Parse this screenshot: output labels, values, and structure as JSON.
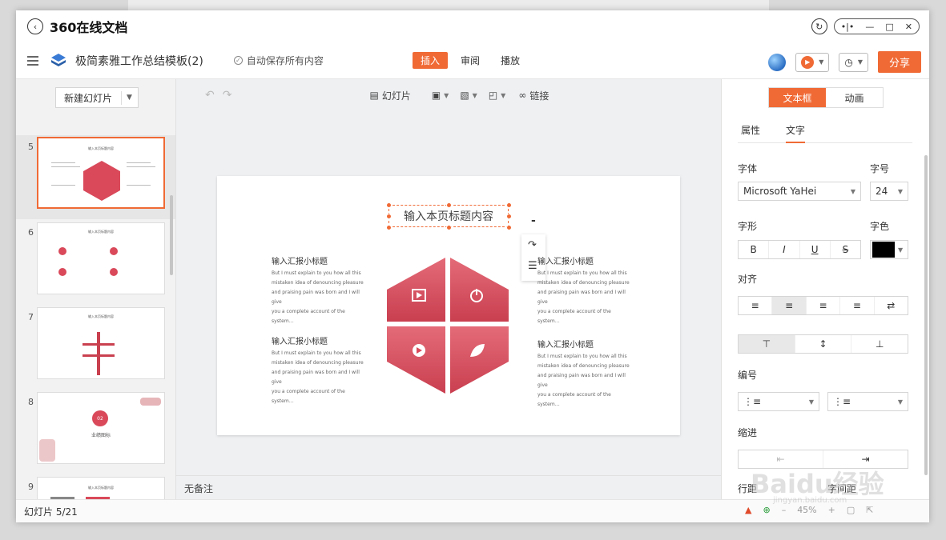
{
  "app": {
    "title": "360在线文档"
  },
  "toolbar": {
    "doc_name": "极简素雅工作总结模板(2)",
    "autosave": "自动保存所有内容",
    "menu_tabs": [
      "插入",
      "审阅",
      "播放"
    ],
    "share_label": "分享"
  },
  "left_panel": {
    "new_slide_label": "新建幻灯片",
    "thumbnails": [
      {
        "number": "5",
        "title": "输入本页标题内容",
        "active": true
      },
      {
        "number": "6",
        "title": "输入本页标题内容"
      },
      {
        "number": "7",
        "title": "输入本页标题内容"
      },
      {
        "number": "8",
        "title": "业绩图标",
        "badge": "02"
      },
      {
        "number": "9",
        "title": "输入本页标题内容"
      }
    ]
  },
  "canvas_tools": {
    "slide_label": "幻灯片",
    "link_label": "链接"
  },
  "slide": {
    "title": "输入本页标题内容",
    "sections": [
      {
        "heading": "输入汇报小标题",
        "lines": [
          "But I must explain to you how all this",
          "mistaken idea of denouncing pleasure",
          "and praising pain was born and I will give",
          "you a complete account of the system…"
        ]
      },
      {
        "heading": "输入汇报小标题",
        "lines": [
          "But I must explain to you how all this",
          "mistaken idea of denouncing pleasure",
          "and praising pain was born and I will give",
          "you a complete account of the system…"
        ]
      },
      {
        "heading": "输入汇报小标题",
        "lines": [
          "But I must explain to you how all this",
          "mistaken idea of denouncing pleasure",
          "and praising pain was born and I will give",
          "you a complete account of the system…"
        ]
      },
      {
        "heading": "输入汇报小标题",
        "lines": [
          "But I must explain to you how all this",
          "mistaken idea of denouncing pleasure",
          "and praising pain was born and I will give",
          "you a complete account of the system…"
        ]
      }
    ],
    "accent_color": "#d9495a"
  },
  "notes": {
    "text": "无备注"
  },
  "right_panel": {
    "seg_tabs": [
      "文本框",
      "动画"
    ],
    "sub_tabs": [
      "属性",
      "文字"
    ],
    "font_label": "字体",
    "font_value": "Microsoft YaHei",
    "size_label": "字号",
    "size_value": "24",
    "style_label": "字形",
    "color_label": "字色",
    "color_value": "#000000",
    "style_buttons": [
      "B",
      "I",
      "U",
      "S"
    ],
    "align_label": "对齐",
    "numbering_label": "编号",
    "indent_label": "缩进",
    "line_spacing_label": "行距",
    "char_spacing_label": "字间距"
  },
  "statusbar": {
    "slide_counter": "幻灯片 5/21",
    "zoom": "45%"
  },
  "watermark": {
    "text": "Baidu经验",
    "sub": "jingyan.baidu.com"
  },
  "colors": {
    "accent": "#f06a35"
  }
}
